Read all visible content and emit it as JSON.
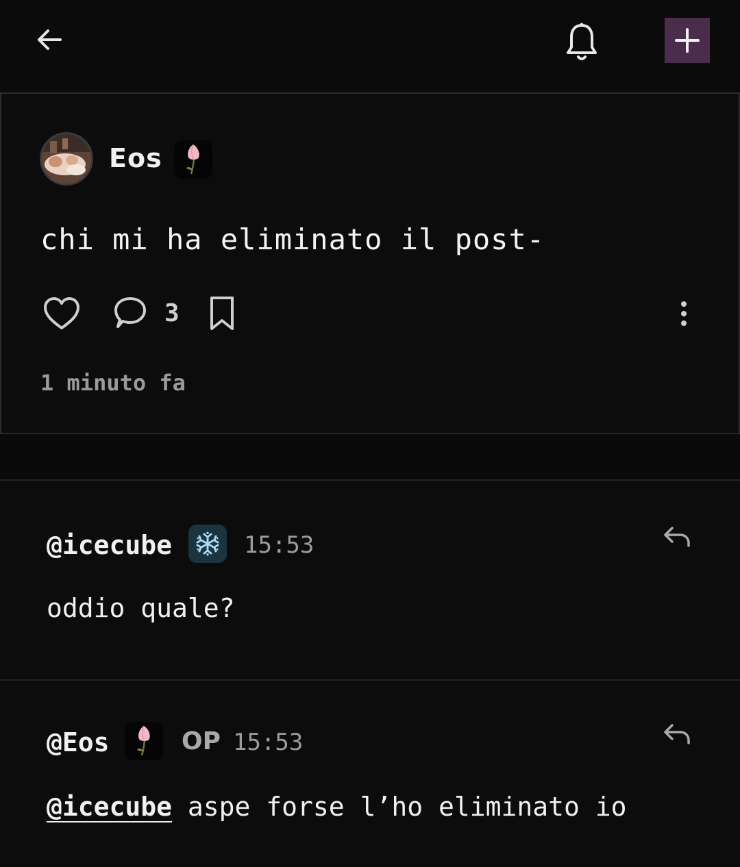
{
  "header": {
    "back_icon": "arrow-left-icon",
    "bell_icon": "bell-icon",
    "new_post_icon": "plus-icon",
    "accent_color": "#4a2d4d"
  },
  "post": {
    "author": "Eos",
    "author_badge_icon": "tulip-icon",
    "text": "chi mi ha eliminato il post-",
    "like_icon": "heart-icon",
    "comment_icon": "comment-bubble-icon",
    "comment_count": "3",
    "bookmark_icon": "bookmark-icon",
    "more_icon": "more-vertical-icon",
    "time_ago": "1 minuto fa"
  },
  "comments": [
    {
      "username": "@icecube",
      "badge_icon": "snowflake-icon",
      "time": "15:53",
      "text": "oddio quale?",
      "reply_icon": "reply-icon"
    },
    {
      "username": "@Eos",
      "badge_icon": "tulip-icon",
      "op_label": "OP",
      "time": "15:53",
      "mention": "@icecube",
      "text": " aspe forse l’ho eliminato io",
      "reply_icon": "reply-icon"
    }
  ]
}
